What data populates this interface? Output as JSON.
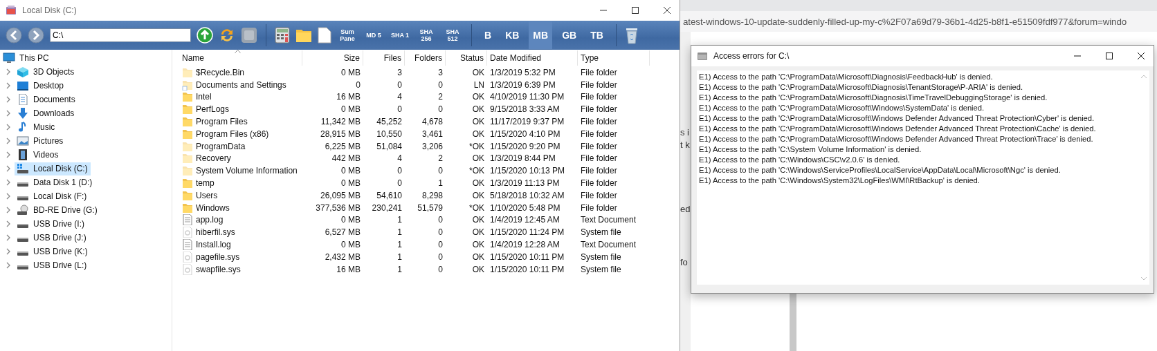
{
  "explorer": {
    "title": "Local Disk (C:)",
    "toolbar": {
      "address": "C:\\",
      "tools": [
        {
          "label": "Sum Pane"
        },
        {
          "label": "MD 5"
        },
        {
          "label": "SHA 1"
        },
        {
          "label": "SHA 256"
        },
        {
          "label": "SHA 512"
        }
      ],
      "units": [
        {
          "label": "B",
          "selected": false
        },
        {
          "label": "KB",
          "selected": false
        },
        {
          "label": "MB",
          "selected": true
        },
        {
          "label": "GB",
          "selected": false
        },
        {
          "label": "TB",
          "selected": false
        }
      ]
    },
    "tree": {
      "label": "This PC",
      "children": [
        {
          "label": "3D Objects",
          "expanded": false,
          "selected": false
        },
        {
          "label": "Desktop",
          "expanded": false,
          "selected": false
        },
        {
          "label": "Documents",
          "expanded": false,
          "selected": false
        },
        {
          "label": "Downloads",
          "expanded": false,
          "selected": false
        },
        {
          "label": "Music",
          "expanded": false,
          "selected": false
        },
        {
          "label": "Pictures",
          "expanded": false,
          "selected": false
        },
        {
          "label": "Videos",
          "expanded": false,
          "selected": false
        },
        {
          "label": "Local Disk (C:)",
          "expanded": false,
          "selected": true
        },
        {
          "label": "Data Disk 1 (D:)",
          "expanded": false,
          "selected": false
        },
        {
          "label": "Local Disk (F:)",
          "expanded": false,
          "selected": false
        },
        {
          "label": "BD-RE Drive (G:)",
          "expanded": false,
          "selected": false
        },
        {
          "label": "USB Drive (I:)",
          "expanded": false,
          "selected": false
        },
        {
          "label": "USB Drive (J:)",
          "expanded": false,
          "selected": false
        },
        {
          "label": "USB Drive (K:)",
          "expanded": false,
          "selected": false
        },
        {
          "label": "USB Drive (L:)",
          "expanded": false,
          "selected": false
        }
      ]
    },
    "columns": [
      "Name",
      "Size",
      "Files",
      "Folders",
      "Status",
      "Date Modified",
      "Type"
    ],
    "rows": [
      {
        "kind": "folder",
        "hidden": true,
        "name": "$Recycle.Bin",
        "size": "0 MB",
        "files": "3",
        "folders": "3",
        "status": "OK",
        "date": "1/3/2019 5:32 PM",
        "type": "File folder"
      },
      {
        "kind": "link",
        "hidden": true,
        "name": "Documents and Settings",
        "size": "0",
        "files": "0",
        "folders": "0",
        "status": "LN",
        "date": "1/3/2019 6:39 PM",
        "type": "File folder"
      },
      {
        "kind": "folder",
        "hidden": false,
        "name": "Intel",
        "size": "16 MB",
        "files": "4",
        "folders": "2",
        "status": "OK",
        "date": "4/10/2019 11:30 PM",
        "type": "File folder"
      },
      {
        "kind": "folder",
        "hidden": false,
        "name": "PerfLogs",
        "size": "0 MB",
        "files": "0",
        "folders": "0",
        "status": "OK",
        "date": "9/15/2018 3:33 AM",
        "type": "File folder"
      },
      {
        "kind": "folder",
        "hidden": false,
        "name": "Program Files",
        "size": "11,342 MB",
        "files": "45,252",
        "folders": "4,678",
        "status": "OK",
        "date": "11/17/2019 9:37 PM",
        "type": "File folder"
      },
      {
        "kind": "folder",
        "hidden": false,
        "name": "Program Files (x86)",
        "size": "28,915 MB",
        "files": "10,550",
        "folders": "3,461",
        "status": "OK",
        "date": "1/15/2020 4:10 PM",
        "type": "File folder"
      },
      {
        "kind": "folder",
        "hidden": true,
        "name": "ProgramData",
        "size": "6,225 MB",
        "files": "51,084",
        "folders": "3,206",
        "status": "*OK",
        "date": "1/15/2020 9:20 PM",
        "type": "File folder"
      },
      {
        "kind": "folder",
        "hidden": true,
        "name": "Recovery",
        "size": "442 MB",
        "files": "4",
        "folders": "2",
        "status": "OK",
        "date": "1/3/2019 8:44 PM",
        "type": "File folder"
      },
      {
        "kind": "folder",
        "hidden": true,
        "name": "System Volume Information",
        "size": "0 MB",
        "files": "0",
        "folders": "0",
        "status": "*OK",
        "date": "1/15/2020 10:13 PM",
        "type": "File folder"
      },
      {
        "kind": "folder",
        "hidden": false,
        "name": "temp",
        "size": "0 MB",
        "files": "0",
        "folders": "1",
        "status": "OK",
        "date": "1/3/2019 11:13 PM",
        "type": "File folder"
      },
      {
        "kind": "folder",
        "hidden": false,
        "name": "Users",
        "size": "26,095 MB",
        "files": "54,610",
        "folders": "8,298",
        "status": "OK",
        "date": "5/18/2018 10:32 AM",
        "type": "File folder"
      },
      {
        "kind": "folder",
        "hidden": false,
        "name": "Windows",
        "size": "377,536 MB",
        "files": "230,241",
        "folders": "51,579",
        "status": "*OK",
        "date": "1/10/2020 5:48 PM",
        "type": "File folder"
      },
      {
        "kind": "text",
        "hidden": false,
        "name": "app.log",
        "size": "0 MB",
        "files": "1",
        "folders": "0",
        "status": "OK",
        "date": "1/4/2019 12:45 AM",
        "type": "Text Document"
      },
      {
        "kind": "system",
        "hidden": true,
        "name": "hiberfil.sys",
        "size": "6,527 MB",
        "files": "1",
        "folders": "0",
        "status": "OK",
        "date": "1/15/2020 11:24 PM",
        "type": "System file"
      },
      {
        "kind": "text",
        "hidden": false,
        "name": "Install.log",
        "size": "0 MB",
        "files": "1",
        "folders": "0",
        "status": "OK",
        "date": "1/4/2019 12:28 AM",
        "type": "Text Document"
      },
      {
        "kind": "system",
        "hidden": true,
        "name": "pagefile.sys",
        "size": "2,432 MB",
        "files": "1",
        "folders": "0",
        "status": "OK",
        "date": "1/15/2020 10:11 PM",
        "type": "System file"
      },
      {
        "kind": "system",
        "hidden": true,
        "name": "swapfile.sys",
        "size": "16 MB",
        "files": "1",
        "folders": "0",
        "status": "OK",
        "date": "1/15/2020 10:11 PM",
        "type": "System file"
      }
    ]
  },
  "browser": {
    "url": "atest-windows-10-update-suddenly-filled-up-my-c%2F07a69d79-36b1-4d25-b8f1-e51509fdf977&forum=windo",
    "fragments": [
      "s i",
      "t k",
      "ed",
      "fo"
    ]
  },
  "dialog": {
    "title": "Access errors for C:\\",
    "lines": [
      "E1) Access to the path 'C:\\ProgramData\\Microsoft\\Diagnosis\\FeedbackHub' is denied.",
      "E1) Access to the path 'C:\\ProgramData\\Microsoft\\Diagnosis\\TenantStorage\\P-ARIA' is denied.",
      "E1) Access to the path 'C:\\ProgramData\\Microsoft\\Diagnosis\\TimeTravelDebuggingStorage' is denied.",
      "E1) Access to the path 'C:\\ProgramData\\Microsoft\\Windows\\SystemData' is denied.",
      "E1) Access to the path 'C:\\ProgramData\\Microsoft\\Windows Defender Advanced Threat Protection\\Cyber' is denied.",
      "E1) Access to the path 'C:\\ProgramData\\Microsoft\\Windows Defender Advanced Threat Protection\\Cache' is denied.",
      "E1) Access to the path 'C:\\ProgramData\\Microsoft\\Windows Defender Advanced Threat Protection\\Trace' is denied.",
      "E1) Access to the path 'C:\\System Volume Information' is denied.",
      "E1) Access to the path 'C:\\Windows\\CSC\\v2.0.6' is denied.",
      "E1) Access to the path 'C:\\Windows\\ServiceProfiles\\LocalService\\AppData\\Local\\Microsoft\\Ngc' is denied.",
      "E1) Access to the path 'C:\\Windows\\System32\\LogFiles\\WMI\\RtBackup' is denied."
    ]
  }
}
